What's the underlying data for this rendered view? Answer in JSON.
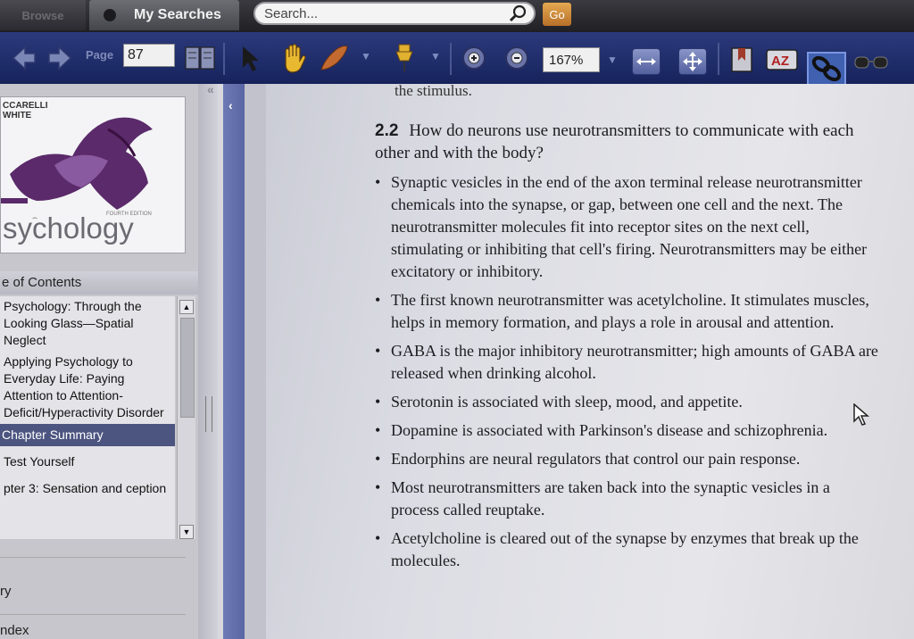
{
  "topbar": {
    "browse_tab": "Browse",
    "my_searches_tab": "My Searches",
    "search_placeholder": "Search...",
    "go_label": "Go"
  },
  "toolbar": {
    "page_label": "Page",
    "page_value": "87",
    "zoom_value": "167%",
    "icons": [
      "prev-page-icon",
      "next-page-icon",
      "two-page-view-icon",
      "select-arrow-icon",
      "hand-icon",
      "highlighter-icon",
      "pin-icon",
      "zoom-in-icon",
      "zoom-out-icon",
      "fit-width-icon",
      "fit-page-icon",
      "bookmark-icon",
      "text-size-icon",
      "link-icon",
      "glasses-icon"
    ]
  },
  "sidebar": {
    "cover": {
      "authors": "CCARELLI\nWHITE",
      "title": "sychology",
      "edition": "FOURTH EDITION"
    },
    "toc_title": "e of Contents",
    "toc_items": [
      {
        "label": "Psychology: Through the Looking Glass—Spatial Neglect"
      },
      {
        "label": "Applying Psychology to Everyday Life: Paying Attention to Attention-Deficit/Hyperactivity Disorder"
      },
      {
        "label": "Chapter Summary",
        "selected": true
      },
      {
        "label": "Test Yourself"
      },
      {
        "label": "pter 3: Sensation and ception"
      }
    ],
    "links": [
      "ry",
      "ndex"
    ]
  },
  "page": {
    "prev_tail": "the stimulus.",
    "heading_num": "2.2",
    "heading_text": "How do neurons use neurotransmitters to communicate with each other and with the body?",
    "bullets": [
      "Synaptic vesicles in the end of the axon terminal release neurotransmitter chemicals into the synapse, or gap, between one cell and the next. The neurotransmitter molecules fit into receptor sites on the next cell, stimulating or inhibiting that cell's firing. Neurotransmitters may be either excitatory or inhibitory.",
      "The first known neurotransmitter was acetylcholine. It stimulates muscles, helps in memory formation, and plays a role in arousal and attention.",
      "GABA is the major inhibitory neurotransmitter; high amounts of GABA are released when drinking alcohol.",
      "Serotonin is associated with sleep, mood, and appetite.",
      "Dopamine is associated with Parkinson's disease and schizophrenia.",
      "Endorphins are neural regulators that control our pain response.",
      "Most neurotransmitters are taken back into the synaptic vesicles in a process called reuptake.",
      "Acetylcholine is cleared out of the synapse by enzymes that break up the molecules."
    ]
  },
  "colors": {
    "toolbar_bg": "#1c2a66",
    "selected_toc": "#4c5580",
    "go_button": "#d08a3a"
  }
}
